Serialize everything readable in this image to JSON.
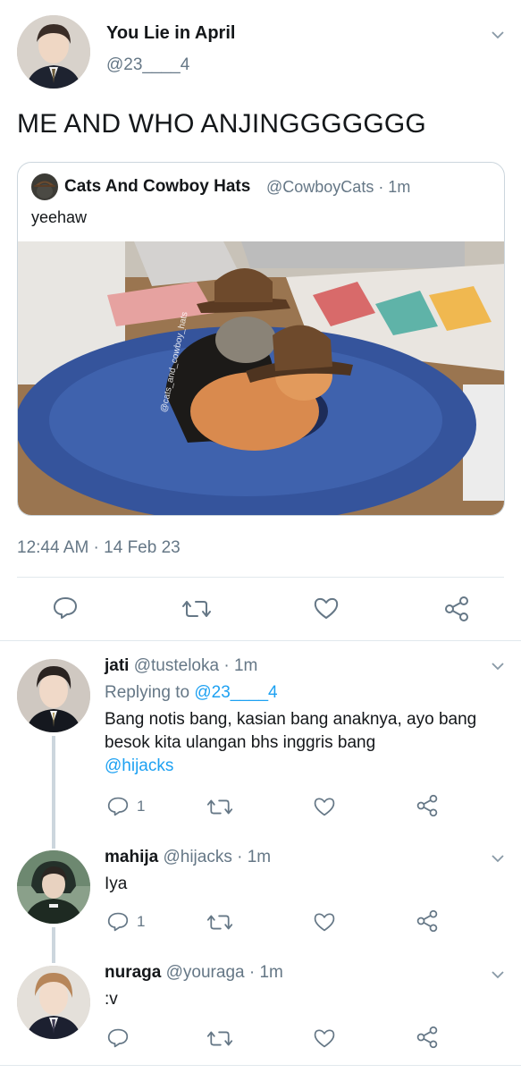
{
  "main_tweet": {
    "author_name": "You Lie in April",
    "author_handle": "@23____4",
    "text": "ME AND WHO ANJINGGGGGGG",
    "timestamp": "12:44 AM · 14 Feb 23",
    "quoted": {
      "author_name": "Cats And Cowboy Hats",
      "meta": "@CowboyCats · 1m",
      "text": "yeehaw",
      "image_watermark": "@cats_and_cowboy_hats"
    },
    "actions": [
      "reply-icon",
      "retweet-icon",
      "like-icon",
      "share-icon"
    ]
  },
  "replies": [
    {
      "name": "jati",
      "meta": "@tusteloka · 1m",
      "replying_to_label": "Replying to",
      "replying_to_handle": "@23____4",
      "text": "Bang notis bang, kasian bang anaknya, ayo bang besok kita ulangan bhs inggris bang",
      "mention": "@hijacks",
      "reply_count": "1"
    },
    {
      "name": "mahija",
      "meta": "@hijacks · 1m",
      "text": "Iya",
      "reply_count": "1"
    },
    {
      "name": "nuraga",
      "meta": "@youraga · 1m",
      "text": ":v",
      "reply_count": ""
    }
  ],
  "colors": {
    "text_primary": "#14171a",
    "text_secondary": "#657786",
    "link": "#1da1f2",
    "divider": "#e1e8ed"
  }
}
